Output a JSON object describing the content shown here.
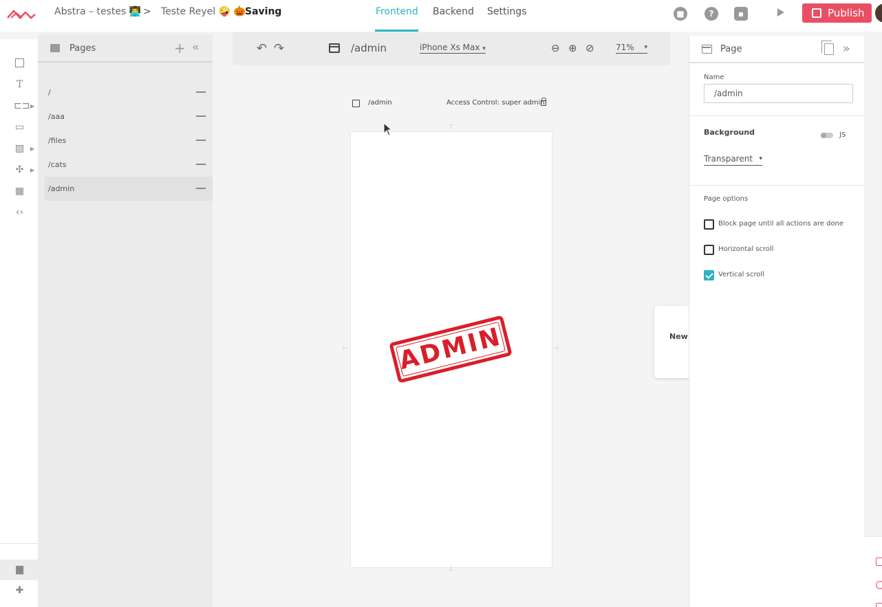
{
  "topbar": {
    "project": "Abstra – testes 👨‍💻",
    "separator": ">",
    "workspace": "Teste Reyel 🤪 🎃",
    "status": "Saving",
    "tabs": [
      {
        "label": "Frontend",
        "active": true
      },
      {
        "label": "Backend",
        "active": false
      },
      {
        "label": "Settings",
        "active": false
      }
    ],
    "icons": [
      "stop-icon",
      "help-icon",
      "save-icon",
      "play-icon"
    ],
    "publish_label": "Publish",
    "accent_color": "#2bb3c0",
    "brand_color": "#e94f64"
  },
  "rail": {
    "icons": [
      "container-icon",
      "text-icon",
      "input-icon",
      "select-icon",
      "image-icon",
      "plugin-icon",
      "table-icon",
      "code-icon",
      "pages-icon",
      "extensions-icon"
    ]
  },
  "pages_panel": {
    "title": "Pages",
    "pages": [
      {
        "path": "/",
        "selected": false
      },
      {
        "path": "/aaa",
        "selected": false
      },
      {
        "path": "/files",
        "selected": false
      },
      {
        "path": "/cats",
        "selected": false
      },
      {
        "path": "/admin",
        "selected": true
      }
    ]
  },
  "canvas_toolbar": {
    "path": "/admin",
    "device": "iPhone Xs Max",
    "zoom": "71%"
  },
  "canvas": {
    "page_path": "/admin",
    "access_control": "Access Control: super admin",
    "stamp_text": "ADMIN",
    "new_card_label": "New a"
  },
  "properties": {
    "title": "Page",
    "name_label": "Name",
    "name_value": "/admin",
    "background_label": "Background",
    "js_label": "JS",
    "background_value": "Transparent",
    "options_title": "Page options",
    "options": [
      {
        "label": "Block page until all actions are done",
        "checked": false
      },
      {
        "label": "Horizontal scroll",
        "checked": false
      },
      {
        "label": "Vertical scroll",
        "checked": true
      }
    ]
  }
}
